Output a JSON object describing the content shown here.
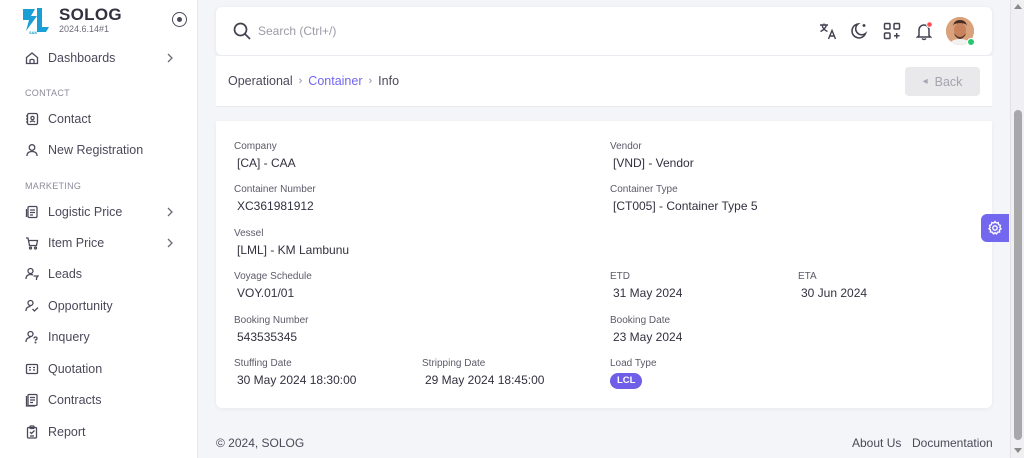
{
  "brand": {
    "name": "SOLOG",
    "version": "2024.6.14#1",
    "logo_sub": "S&K"
  },
  "sidebar": {
    "items": [
      {
        "label": "Dashboards",
        "icon": "home-icon",
        "chevron": true
      },
      {
        "section": "CONTACT"
      },
      {
        "label": "Contact",
        "icon": "address-book-icon"
      },
      {
        "label": "New Registration",
        "icon": "user-icon"
      },
      {
        "section": "MARKETING"
      },
      {
        "label": "Logistic Price",
        "icon": "document-icon",
        "chevron": true
      },
      {
        "label": "Item Price",
        "icon": "cart-icon",
        "chevron": true
      },
      {
        "label": "Leads",
        "icon": "user-filter-icon"
      },
      {
        "label": "Opportunity",
        "icon": "handshake-icon"
      },
      {
        "label": "Inquery",
        "icon": "user-question-icon"
      },
      {
        "label": "Quotation",
        "icon": "receipt-icon"
      },
      {
        "label": "Contracts",
        "icon": "contract-icon"
      },
      {
        "label": "Report",
        "icon": "clipboard-icon"
      }
    ]
  },
  "navbar": {
    "search_placeholder": "Search (Ctrl+/)",
    "icons": [
      "translate-icon",
      "moon-icon",
      "apps-icon",
      "bell-icon"
    ],
    "notification_color": "#ff4c51",
    "online_color": "#28c76f"
  },
  "breadcrumb": {
    "root": "Operational",
    "link": "Container",
    "current": "Info"
  },
  "back_label": "Back",
  "fields": {
    "company": {
      "label": "Company",
      "value": "[CA] - CAA"
    },
    "vendor": {
      "label": "Vendor",
      "value": "[VND] - Vendor"
    },
    "container_number": {
      "label": "Container Number",
      "value": "XC361981912"
    },
    "container_type": {
      "label": "Container Type",
      "value": "[CT005] - Container Type 5"
    },
    "vessel": {
      "label": "Vessel",
      "value": "[LML] - KM Lambunu"
    },
    "voyage_schedule": {
      "label": "Voyage Schedule",
      "value": "VOY.01/01"
    },
    "etd": {
      "label": "ETD",
      "value": "31 May 2024"
    },
    "eta": {
      "label": "ETA",
      "value": "30 Jun 2024"
    },
    "booking_number": {
      "label": "Booking Number",
      "value": "543535345"
    },
    "booking_date": {
      "label": "Booking Date",
      "value": "23 May 2024"
    },
    "stuffing_date": {
      "label": "Stuffing Date",
      "value": "30 May 2024 18:30:00"
    },
    "stripping_date": {
      "label": "Stripping Date",
      "value": "29 May 2024 18:45:00"
    },
    "load_type": {
      "label": "Load Type",
      "value": "LCL"
    }
  },
  "footer": {
    "copyright": "© 2024, SOLOG",
    "about": "About Us",
    "docs": "Documentation"
  },
  "colors": {
    "primary": "#7367f0",
    "background": "#f4f5f8"
  }
}
